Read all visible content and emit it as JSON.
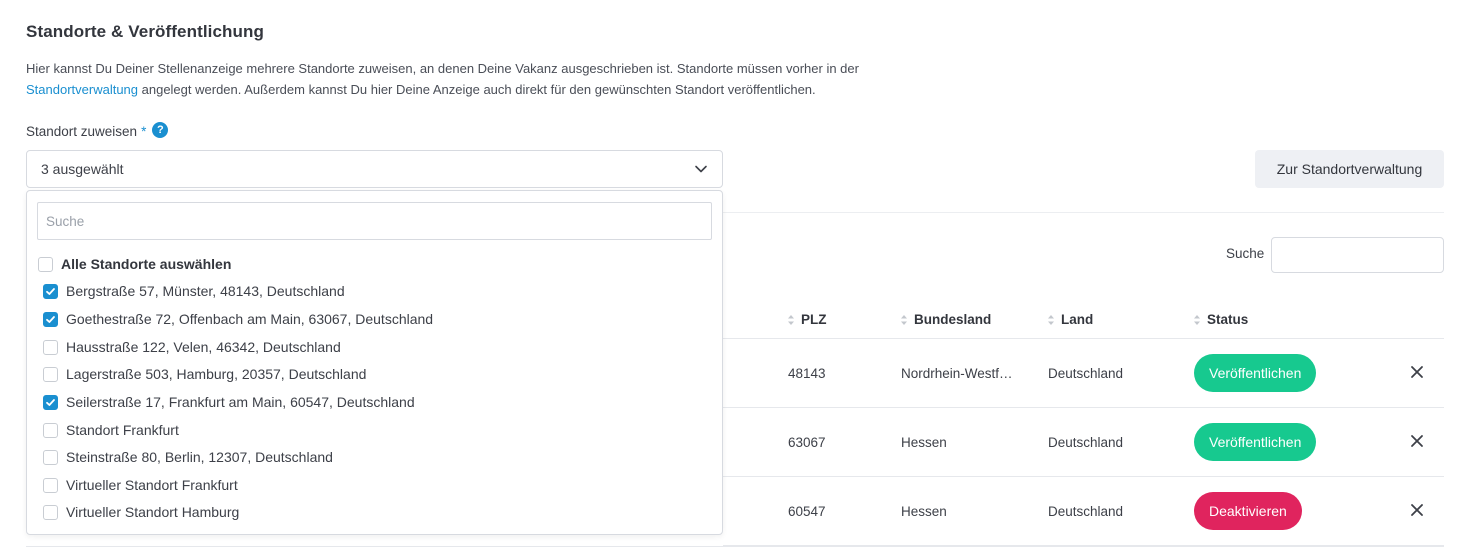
{
  "section": {
    "title": "Standorte & Veröffentlichung",
    "desc_part1": "Hier kannst Du Deiner Stellenanzeige mehrere Standorte zuweisen, an denen Deine Vakanz ausgeschrieben ist. Standorte müssen vorher in der",
    "desc_link": "Standortverwaltung",
    "desc_part2": " angelegt werden. Außerdem kannst Du hier Deine Anzeige auch direkt für den gewünschten Standort veröffentlichen."
  },
  "field": {
    "label": "Standort zuweisen",
    "required_mark": "*",
    "help_icon": "?",
    "selected_text": "3 ausgewählt"
  },
  "manage_button": "Zur Standortverwaltung",
  "table": {
    "search_label": "Suche",
    "headers": {
      "plz": "PLZ",
      "bundesland": "Bundesland",
      "land": "Land",
      "status": "Status"
    },
    "rows": [
      {
        "plz": "48143",
        "bundesland": "Nordrhein-Westf…",
        "land": "Deutschland",
        "action": "Veröffentlichen"
      },
      {
        "plz": "63067",
        "bundesland": "Hessen",
        "land": "Deutschland",
        "action": "Veröffentlichen"
      },
      {
        "plz": "60547",
        "bundesland": "Hessen",
        "land": "Deutschland",
        "action": "Deaktivieren"
      }
    ]
  },
  "dropdown": {
    "search_placeholder": "Suche",
    "select_all": "Alle Standorte auswählen",
    "options": [
      {
        "label": "Bergstraße 57, Münster, 48143, Deutschland",
        "checked": true
      },
      {
        "label": "Goethestraße 72, Offenbach am Main, 63067, Deutschland",
        "checked": true
      },
      {
        "label": "Hausstraße 122, Velen, 46342, Deutschland",
        "checked": false
      },
      {
        "label": "Lagerstraße 503, Hamburg, 20357, Deutschland",
        "checked": false
      },
      {
        "label": "Seilerstraße 17, Frankfurt am Main, 60547, Deutschland",
        "checked": true
      },
      {
        "label": "Standort Frankfurt",
        "checked": false
      },
      {
        "label": "Steinstraße 80, Berlin, 12307, Deutschland",
        "checked": false
      },
      {
        "label": "Virtueller Standort Frankfurt",
        "checked": false
      },
      {
        "label": "Virtueller Standort Hamburg",
        "checked": false
      }
    ]
  },
  "colors": {
    "accent": "#1a8fd0",
    "publish": "#17c98f",
    "deactivate": "#e0245e"
  }
}
